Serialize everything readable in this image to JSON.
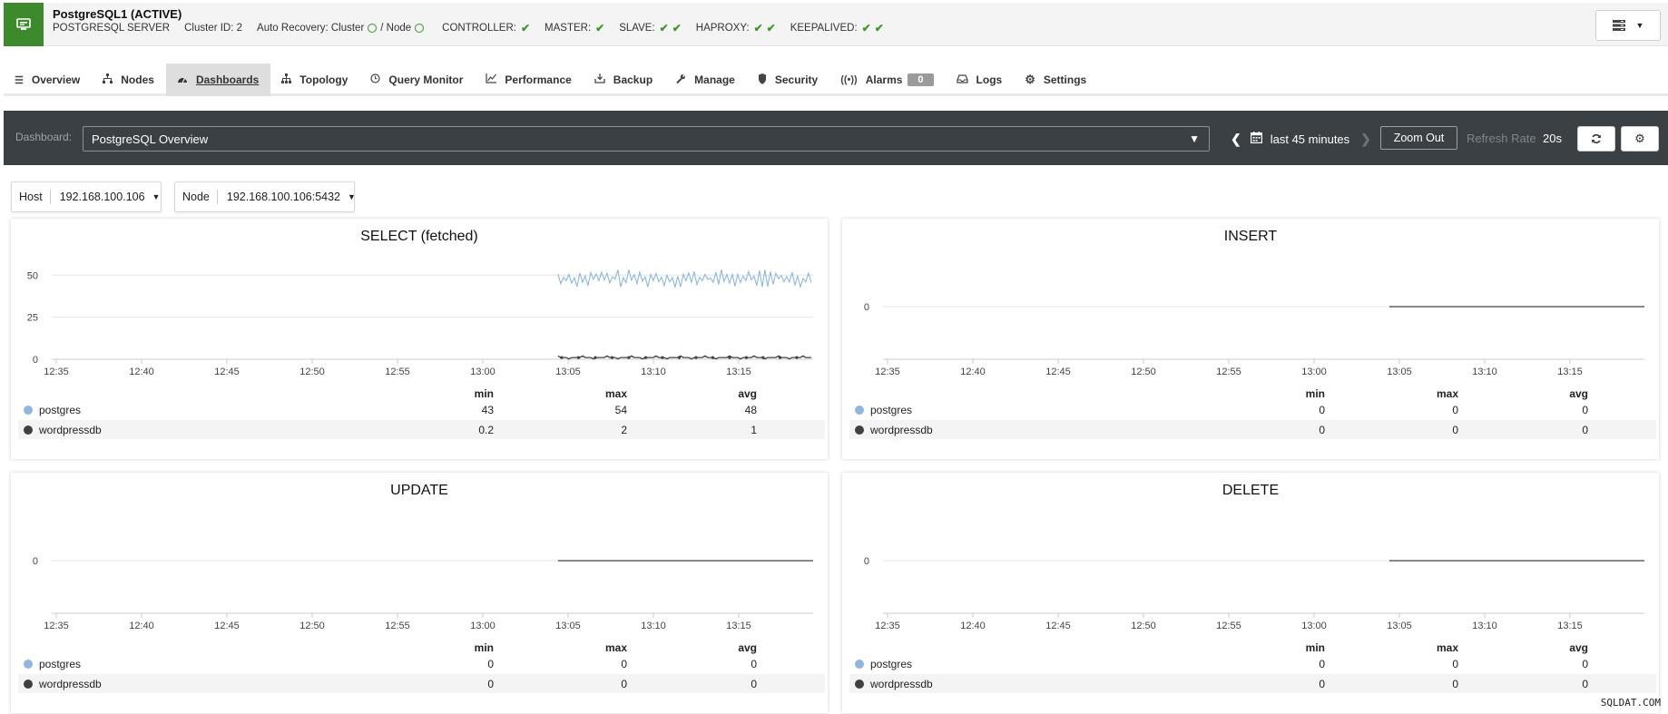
{
  "header": {
    "title": "PostgreSQL1 (ACTIVE)",
    "server_type": "POSTGRESQL SERVER",
    "cluster_id": "Cluster ID: 2",
    "auto_recovery_label": "Auto Recovery: Cluster",
    "node_label": "/ Node",
    "statuses": [
      {
        "label": "CONTROLLER:",
        "checks": 1
      },
      {
        "label": "MASTER:",
        "checks": 1
      },
      {
        "label": "SLAVE:",
        "checks": 2
      },
      {
        "label": "HAPROXY:",
        "checks": 2
      },
      {
        "label": "KEEPALIVED:",
        "checks": 2
      }
    ]
  },
  "tabs": [
    {
      "label": "Overview",
      "icon": "list-icon"
    },
    {
      "label": "Nodes",
      "icon": "sitemap-icon"
    },
    {
      "label": "Dashboards",
      "icon": "dashboard-icon",
      "active": true
    },
    {
      "label": "Topology",
      "icon": "topology-icon"
    },
    {
      "label": "Query Monitor",
      "icon": "clock-icon"
    },
    {
      "label": "Performance",
      "icon": "line-chart-icon"
    },
    {
      "label": "Backup",
      "icon": "download-icon"
    },
    {
      "label": "Manage",
      "icon": "wrench-icon"
    },
    {
      "label": "Security",
      "icon": "shield-icon"
    },
    {
      "label": "Alarms",
      "icon": "broadcast-icon",
      "badge": "0"
    },
    {
      "label": "Logs",
      "icon": "inbox-icon"
    },
    {
      "label": "Settings",
      "icon": "gear-icon"
    }
  ],
  "dashboard_bar": {
    "label": "Dashboard:",
    "selected": "PostgreSQL Overview",
    "time_range": "last 45 minutes",
    "zoom_out": "Zoom Out",
    "refresh_label": "Refresh Rate",
    "refresh_value": "20s"
  },
  "filters": {
    "host_label": "Host",
    "host_value": "192.168.100.106",
    "node_label": "Node",
    "node_value": "192.168.100.106:5432"
  },
  "colors": {
    "postgres": "#8db7e0",
    "wordpressdb": "#404040",
    "active_green": "#3d8a2c",
    "dashbar_bg": "#3b4045"
  },
  "legend_headers": {
    "min": "min",
    "max": "max",
    "avg": "avg"
  },
  "x_ticks": [
    "12:35",
    "12:40",
    "12:45",
    "12:50",
    "12:55",
    "13:00",
    "13:05",
    "13:10",
    "13:15"
  ],
  "chart_data": [
    {
      "type": "line",
      "title": "SELECT (fetched)",
      "y_ticks": [
        "50",
        "25",
        "0"
      ],
      "ylim": [
        0,
        55
      ],
      "series": [
        {
          "name": "postgres",
          "min": "43",
          "max": "54",
          "avg": "48"
        },
        {
          "name": "wordpressdb",
          "min": "0.2",
          "max": "2",
          "avg": "1"
        }
      ]
    },
    {
      "type": "line",
      "title": "INSERT",
      "y_ticks": [
        "0"
      ],
      "series": [
        {
          "name": "postgres",
          "min": "0",
          "max": "0",
          "avg": "0"
        },
        {
          "name": "wordpressdb",
          "min": "0",
          "max": "0",
          "avg": "0"
        }
      ]
    },
    {
      "type": "line",
      "title": "UPDATE",
      "y_ticks": [
        "0"
      ],
      "series": [
        {
          "name": "postgres",
          "min": "0",
          "max": "0",
          "avg": "0"
        },
        {
          "name": "wordpressdb",
          "min": "0",
          "max": "0",
          "avg": "0"
        }
      ]
    },
    {
      "type": "line",
      "title": "DELETE",
      "y_ticks": [
        "0"
      ],
      "series": [
        {
          "name": "postgres",
          "min": "0",
          "max": "0",
          "avg": "0"
        },
        {
          "name": "wordpressdb",
          "min": "0",
          "max": "0",
          "avg": "0"
        }
      ]
    }
  ],
  "watermark": "SQLDAT.COM"
}
